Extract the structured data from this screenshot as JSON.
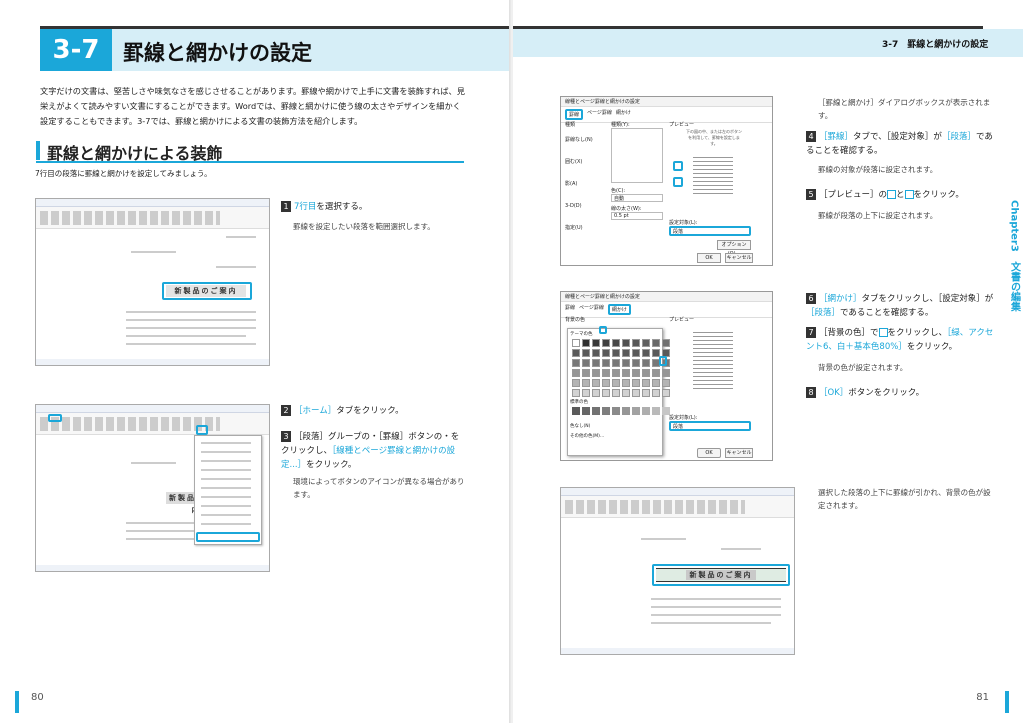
{
  "section": {
    "number": "3-7",
    "title": "罫線と網かけの設定",
    "running_head": "3-7　罫線と網かけの設定"
  },
  "intro": "文字だけの文書は、堅苦しさや味気なさを感じさせることがあります。罫線や網かけで上手に文書を装飾すれば、見栄えがよくて読みやすい文書にすることができます。Wordでは、罫線と網かけに使う線の太さやデザインを細かく設定することもできます。3-7では、罫線と網かけによる文書の装飾方法を紹介します。",
  "heading": "罫線と網かけによる装飾",
  "lead": "7行目の段落に罫線と網かけを設定してみましょう。",
  "doc_title": "新製品のご案内",
  "steps_left": [
    {
      "n": "1",
      "text_pre": "",
      "link": "7行目",
      "text_post": "を選択する。",
      "note": "罫線を設定したい段落を範囲選択します。"
    },
    {
      "n": "2",
      "text_pre": "",
      "link": "［ホーム］",
      "text_post": "タブをクリック。",
      "note": ""
    },
    {
      "n": "3",
      "text_pre": "［段落］グループの",
      "link": "［線種とページ罫線と網かけの設定...］",
      "text_post": "をクリック。",
      "text_mid": "・［罫線］ボタンの・をクリックし、",
      "note": "環境によってボタンのアイコンが異なる場合があります。"
    }
  ],
  "steps_right": [
    {
      "pre_note": "［罫線と網かけ］ダイアログボックスが表示されます。"
    },
    {
      "n": "4",
      "link1": "［罫線］",
      "mid": "タブで、［設定対象］が",
      "link2": "［段落］",
      "post": "であることを確認する。",
      "note": "罫線の対象が段落に設定されます。"
    },
    {
      "n": "5",
      "pre": "［プレビュー］の",
      "post": "をクリック。",
      "mid": "と",
      "note": "罫線が段落の上下に設定されます。"
    },
    {
      "n": "6",
      "link1": "［網かけ］",
      "mid": "タブをクリックし、［設定対象］が",
      "link2": "［段落］",
      "post": "であることを確認する。"
    },
    {
      "n": "7",
      "pre": "［背景の色］で",
      "mid": "をクリックし、",
      "link": "［緑、アクセント6、白＋基本色80%］",
      "post": "をクリック。",
      "note": "背景の色が設定されます。"
    },
    {
      "n": "8",
      "link": "［OK］",
      "post": "ボタンをクリック。"
    }
  ],
  "final_note": "選択した段落の上下に罫線が引かれ、背景の色が設定されます。",
  "dialog": {
    "title": "線種とページ罫線と網かけの設定",
    "tabs": [
      "罫線",
      "ページ罫線",
      "網かけ"
    ],
    "preview_label": "プレビュー",
    "preview_hint": "下の図の中、または左のボタンを利用して、罫線を設定します。",
    "apply_label": "設定対象(L):",
    "apply_value": "段落",
    "options": "オプション(O)...",
    "ok": "OK",
    "cancel": "キャンセル",
    "setting_label": "種類",
    "settings": [
      "罫線なし(N)",
      "囲む(X)",
      "影(A)",
      "3-D(D)",
      "指定(U)"
    ],
    "style_label": "種類(Y):",
    "color_label": "色(C):",
    "color_value": "自動",
    "width_label": "線の太さ(W):",
    "width_value": "0.5 pt",
    "fill_label": "背景の色",
    "theme_label": "テーマの色",
    "std_label": "標準の色",
    "no_color": "色なし(N)",
    "more": "その他の色(M)..."
  },
  "chapter_tab": "Chapter3　文書の編集",
  "pages": {
    "left": "80",
    "right": "81"
  },
  "colors": {
    "accent": "#1ba7d9",
    "band": "#d6eef7"
  }
}
